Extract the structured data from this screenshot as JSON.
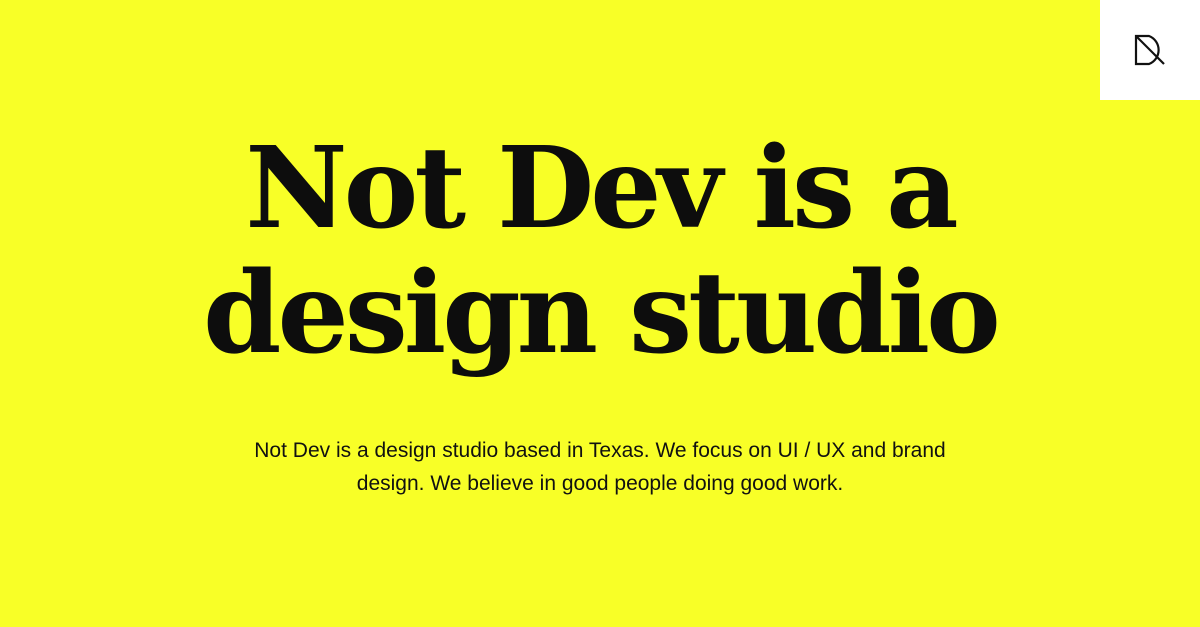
{
  "brand": {
    "logo_icon": "not-dev-logo-icon",
    "background_color": "#f8ff27",
    "logo_box_color": "#ffffff",
    "text_color": "#0d0d0d"
  },
  "hero": {
    "headline_line1": "Not Dev is a",
    "headline_line2": "design studio",
    "description": "Not Dev is a design studio based in Texas. We focus on UI / UX and brand design. We believe in good people doing good work."
  }
}
